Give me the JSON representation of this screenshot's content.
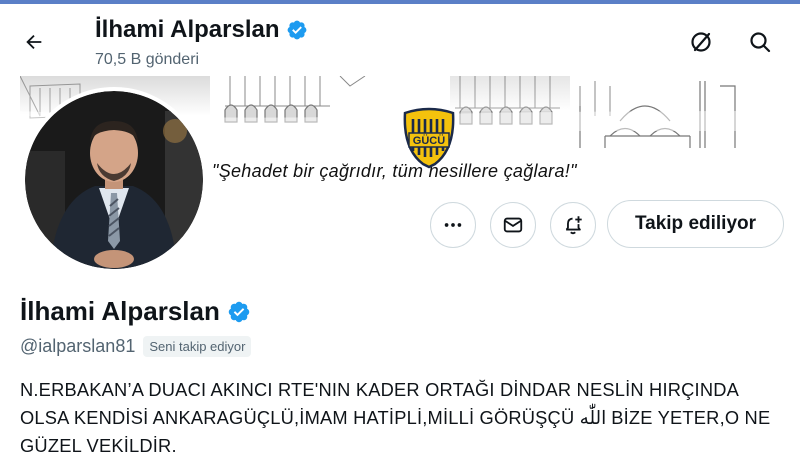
{
  "header": {
    "title": "İlhami Alparslan",
    "post_count": "70,5 B gönderi"
  },
  "banner": {
    "quote": "\"Şehadet bir çağrıdır, tüm nesillere çağlara!\"",
    "logo_text": "GÜCÜ"
  },
  "actions": {
    "follow_label": "Takip ediliyor"
  },
  "profile": {
    "name": "İlhami Alparslan",
    "handle": "@ialparslan81",
    "follows_you": "Seni takip ediyor",
    "bio": "N.ERBAKAN’A DUACI AKINCI RTE'NIN KADER ORTAĞI DİNDAR NESLİN HIRÇINDA OLSA KENDİSİ ANKARAGÜÇLÜ,İMAM HATİPLİ,MİLLİ GÖRÜŞÇÜ اللّٰه BİZE YETER,O NE GÜZEL VEKİLDİR."
  },
  "colors": {
    "verified": "#1d9bf0",
    "secondary_text": "#536471",
    "logo_yellow": "#f4c20d",
    "logo_navy": "#1b2a4a"
  }
}
